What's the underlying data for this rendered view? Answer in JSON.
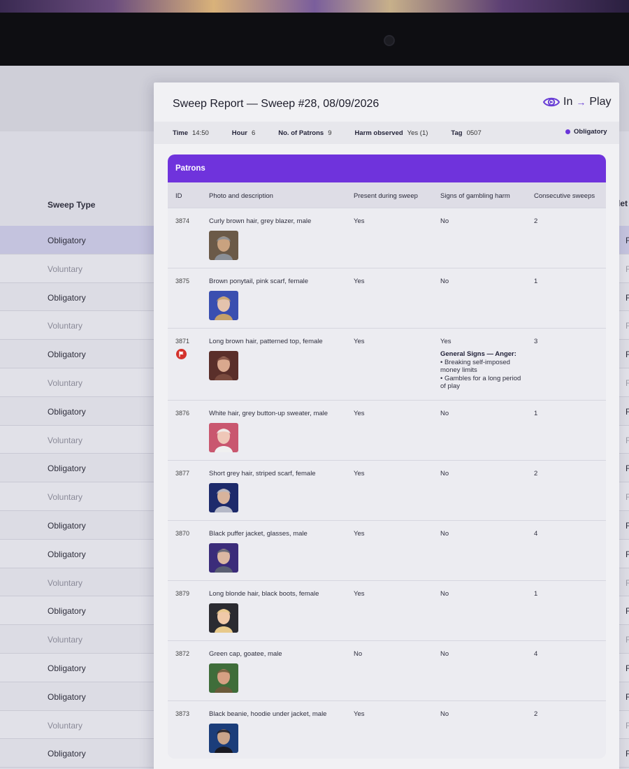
{
  "background_app": {
    "column_header": "Sweep Type",
    "right_header_fragment": "let",
    "rows": [
      {
        "label": "Obligatory",
        "right": "F",
        "selected": true
      },
      {
        "label": "Voluntary",
        "right": "F"
      },
      {
        "label": "Obligatory",
        "right": "F"
      },
      {
        "label": "Voluntary",
        "right": "F"
      },
      {
        "label": "Obligatory",
        "right": "F"
      },
      {
        "label": "Voluntary",
        "right": "F"
      },
      {
        "label": "Obligatory",
        "right": "F"
      },
      {
        "label": "Voluntary",
        "right": "F"
      },
      {
        "label": "Obligatory",
        "right": "F"
      },
      {
        "label": "Voluntary",
        "right": "F"
      },
      {
        "label": "Obligatory",
        "right": "F"
      },
      {
        "label": "Obligatory",
        "right": "F"
      },
      {
        "label": "Voluntary",
        "right": "F"
      },
      {
        "label": "Obligatory",
        "right": "F"
      },
      {
        "label": "Voluntary",
        "right": "F"
      },
      {
        "label": "Obligatory",
        "right": "F"
      },
      {
        "label": "Obligatory",
        "right": "F"
      },
      {
        "label": "Voluntary",
        "right": "F"
      },
      {
        "label": "Obligatory",
        "right": "F"
      }
    ]
  },
  "report": {
    "title": "Sweep Report — Sweep #28, 08/09/2026",
    "logo": {
      "left": "In",
      "arrow": "→",
      "right": "Play",
      "icon": "eye-logo-icon"
    },
    "meta": {
      "time_label": "Time",
      "time": "14:50",
      "hour_label": "Hour",
      "hour": "6",
      "patrons_label": "No. of Patrons",
      "patrons": "9",
      "harm_label": "Harm observed",
      "harm": "Yes (1)",
      "tag_label": "Tag",
      "tag": "0507",
      "type": "Obligatory",
      "type_color": "#6a35d9"
    },
    "patrons_title": "Patrons",
    "columns": {
      "id": "ID",
      "desc": "Photo and description",
      "present": "Present during sweep",
      "signs": "Signs of gambling harm",
      "consecutive": "Consecutive sweeps"
    },
    "rows": [
      {
        "id": "3874",
        "desc": "Curly brown hair, grey blazer, male",
        "present": "Yes",
        "signs": "No",
        "consecutive": "2"
      },
      {
        "id": "3875",
        "desc": "Brown ponytail, pink scarf, female",
        "present": "Yes",
        "signs": "No",
        "consecutive": "1"
      },
      {
        "id": "3871",
        "desc": "Long brown hair, patterned top, female",
        "present": "Yes",
        "signs": "Yes",
        "consecutive": "3",
        "flagged": true,
        "signs_title": "General Signs — Anger:",
        "signs_items": [
          "• Breaking self-imposed money limits",
          "• Gambles for a long period of play"
        ]
      },
      {
        "id": "3876",
        "desc": "White hair, grey button-up sweater, male",
        "present": "Yes",
        "signs": "No",
        "consecutive": "1"
      },
      {
        "id": "3877",
        "desc": "Short grey hair, striped scarf, female",
        "present": "Yes",
        "signs": "No",
        "consecutive": "2"
      },
      {
        "id": "3870",
        "desc": "Black puffer jacket, glasses, male",
        "present": "Yes",
        "signs": "No",
        "consecutive": "4"
      },
      {
        "id": "3879",
        "desc": "Long blonde hair, black boots, female",
        "present": "Yes",
        "signs": "No",
        "consecutive": "1"
      },
      {
        "id": "3872",
        "desc": "Green cap, goatee, male",
        "present": "No",
        "signs": "No",
        "consecutive": "4"
      },
      {
        "id": "3873",
        "desc": "Black beanie, hoodie under jacket, male",
        "present": "Yes",
        "signs": "No",
        "consecutive": "2"
      }
    ]
  }
}
